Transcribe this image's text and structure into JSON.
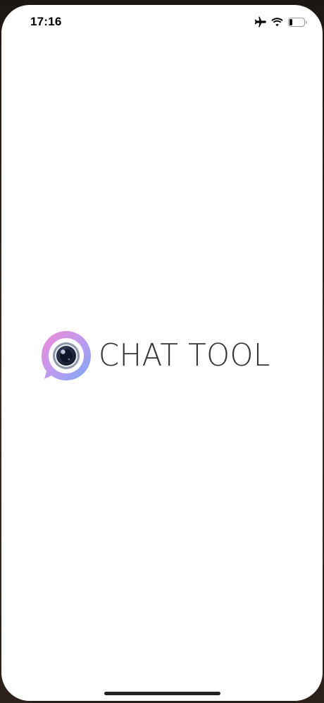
{
  "status_bar": {
    "time": "17:16",
    "icons": [
      "airplane-mode-icon",
      "wifi-icon",
      "battery-icon"
    ],
    "battery_level": 0.2
  },
  "splash": {
    "brand_name": "CHAT TOOL",
    "logo_icon": "chat-camera-logo-icon",
    "colors": {
      "gradient_start": "#e58be0",
      "gradient_end": "#7fa6f5",
      "lens_dark": "#1f2a44",
      "text": "#333333"
    }
  }
}
